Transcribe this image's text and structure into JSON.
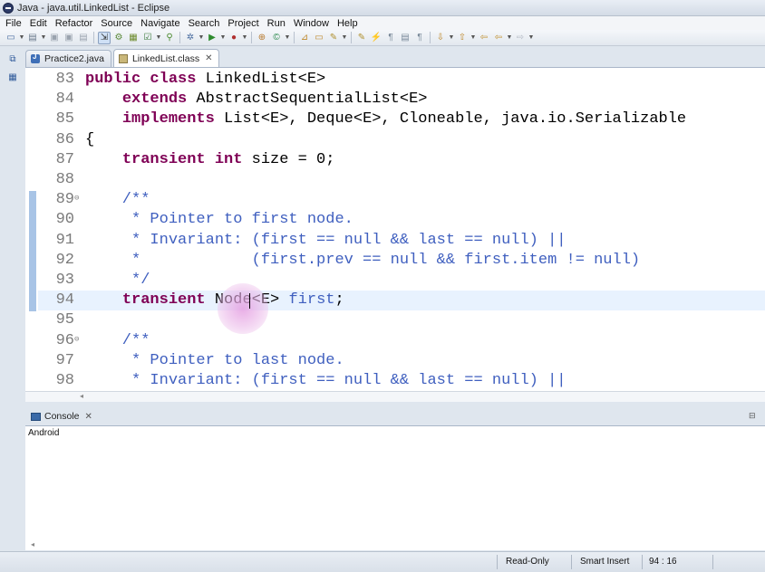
{
  "window": {
    "title": "Java - java.util.LinkedList - Eclipse"
  },
  "menu": [
    "File",
    "Edit",
    "Refactor",
    "Source",
    "Navigate",
    "Search",
    "Project",
    "Run",
    "Window",
    "Help"
  ],
  "editor_tabs": [
    {
      "label": "Practice2.java",
      "active": false
    },
    {
      "label": "LinkedList.class",
      "active": true
    }
  ],
  "code_lines": [
    {
      "num": "83",
      "fold": "",
      "segments": [
        [
          "kw",
          "public class"
        ],
        [
          "",
          "LinkedList<E>"
        ]
      ]
    },
    {
      "num": "84",
      "fold": "",
      "segments": [
        [
          "",
          "    "
        ],
        [
          "kw",
          "extends"
        ],
        [
          "",
          " AbstractSequentialList<E>"
        ]
      ]
    },
    {
      "num": "85",
      "fold": "",
      "segments": [
        [
          "",
          "    "
        ],
        [
          "kw",
          "implements"
        ],
        [
          "",
          " List<E>, Deque<E>, Cloneable, java.io.Serializable"
        ]
      ]
    },
    {
      "num": "86",
      "fold": "",
      "segments": [
        [
          "",
          "{"
        ]
      ]
    },
    {
      "num": "87",
      "fold": "",
      "segments": [
        [
          "",
          "    "
        ],
        [
          "kw",
          "transient int"
        ],
        [
          "",
          " size = 0;"
        ]
      ]
    },
    {
      "num": "88",
      "fold": "",
      "segments": []
    },
    {
      "num": "89",
      "fold": "⊖",
      "segments": [
        [
          "cm",
          "    /**"
        ]
      ]
    },
    {
      "num": "90",
      "fold": "",
      "segments": [
        [
          "cm",
          "     * Pointer to first node."
        ]
      ]
    },
    {
      "num": "91",
      "fold": "",
      "segments": [
        [
          "cm",
          "     * Invariant: (first == null && last == null) ||"
        ]
      ]
    },
    {
      "num": "92",
      "fold": "",
      "segments": [
        [
          "cm",
          "     *            (first.prev == null && first.item != null)"
        ]
      ]
    },
    {
      "num": "93",
      "fold": "",
      "segments": [
        [
          "cm",
          "     */"
        ]
      ]
    },
    {
      "num": "94",
      "fold": "",
      "current": true,
      "segments": [
        [
          "",
          "    "
        ],
        [
          "kw",
          "transient"
        ],
        [
          "",
          " Node<E> "
        ],
        [
          "cm",
          "first"
        ],
        [
          "",
          ";"
        ]
      ]
    },
    {
      "num": "95",
      "fold": "",
      "segments": []
    },
    {
      "num": "96",
      "fold": "⊖",
      "segments": [
        [
          "cm",
          "    /**"
        ]
      ]
    },
    {
      "num": "97",
      "fold": "",
      "segments": [
        [
          "cm",
          "     * Pointer to last node."
        ]
      ]
    },
    {
      "num": "98",
      "fold": "",
      "segments": [
        [
          "cm",
          "     * Invariant: (first == null && last == null) ||"
        ]
      ]
    }
  ],
  "console": {
    "tab_label": "Console",
    "output": "Android"
  },
  "status": {
    "mode": "Read-Only",
    "insert": "Smart Insert",
    "position": "94 : 16"
  },
  "colors": {
    "keyword": "#7f0055",
    "comment": "#3f5fbf",
    "current_line": "#e8f2fe"
  }
}
